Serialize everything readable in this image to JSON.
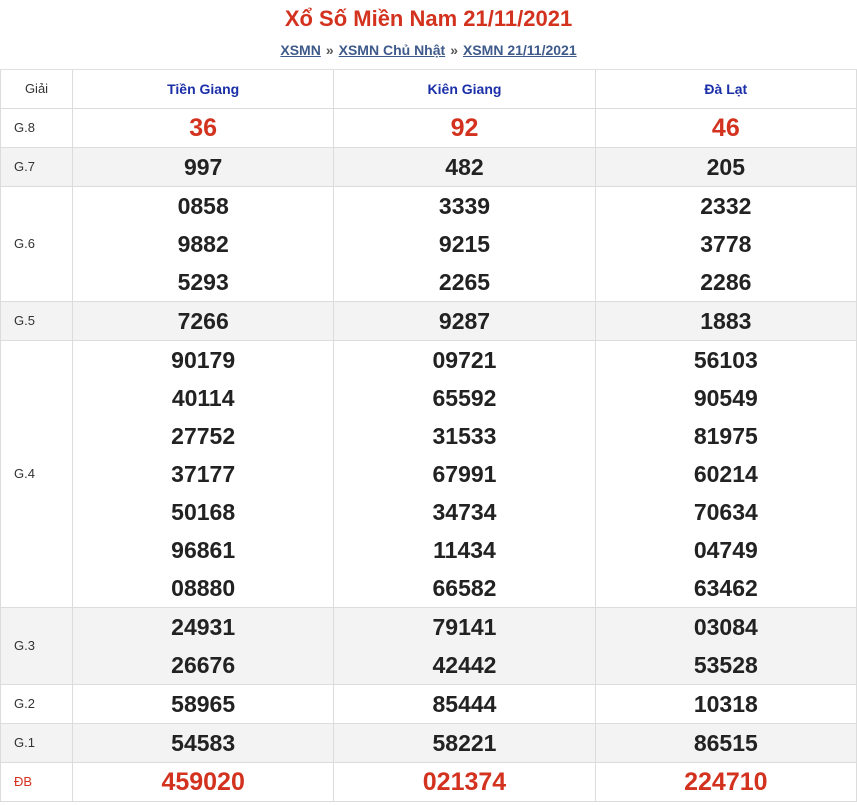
{
  "header": {
    "title": "Xổ Số Miền Nam 21/11/2021",
    "breadcrumb": [
      "XSMN",
      "XSMN Chủ Nhật",
      "XSMN 21/11/2021"
    ],
    "separator": "»"
  },
  "table": {
    "prize_header": "Giải",
    "provinces": [
      "Tiền Giang",
      "Kiên Giang",
      "Đà Lạt"
    ],
    "colors": {
      "accent": "#d3321f",
      "province": "#1a2fa8",
      "link": "#3e5a8a"
    },
    "rows": [
      {
        "label": "G.8",
        "results": [
          [
            "36"
          ],
          [
            "92"
          ],
          [
            "46"
          ]
        ]
      },
      {
        "label": "G.7",
        "results": [
          [
            "997"
          ],
          [
            "482"
          ],
          [
            "205"
          ]
        ]
      },
      {
        "label": "G.6",
        "results": [
          [
            "0858",
            "9882",
            "5293"
          ],
          [
            "3339",
            "9215",
            "2265"
          ],
          [
            "2332",
            "3778",
            "2286"
          ]
        ]
      },
      {
        "label": "G.5",
        "results": [
          [
            "7266"
          ],
          [
            "9287"
          ],
          [
            "1883"
          ]
        ]
      },
      {
        "label": "G.4",
        "results": [
          [
            "90179",
            "40114",
            "27752",
            "37177",
            "50168",
            "96861",
            "08880"
          ],
          [
            "09721",
            "65592",
            "31533",
            "67991",
            "34734",
            "11434",
            "66582"
          ],
          [
            "56103",
            "90549",
            "81975",
            "60214",
            "70634",
            "04749",
            "63462"
          ]
        ]
      },
      {
        "label": "G.3",
        "results": [
          [
            "24931",
            "26676"
          ],
          [
            "79141",
            "42442"
          ],
          [
            "03084",
            "53528"
          ]
        ]
      },
      {
        "label": "G.2",
        "results": [
          [
            "58965"
          ],
          [
            "85444"
          ],
          [
            "10318"
          ]
        ]
      },
      {
        "label": "G.1",
        "results": [
          [
            "54583"
          ],
          [
            "58221"
          ],
          [
            "86515"
          ]
        ]
      },
      {
        "label": "ĐB",
        "results": [
          [
            "459020"
          ],
          [
            "021374"
          ],
          [
            "224710"
          ]
        ]
      }
    ]
  }
}
